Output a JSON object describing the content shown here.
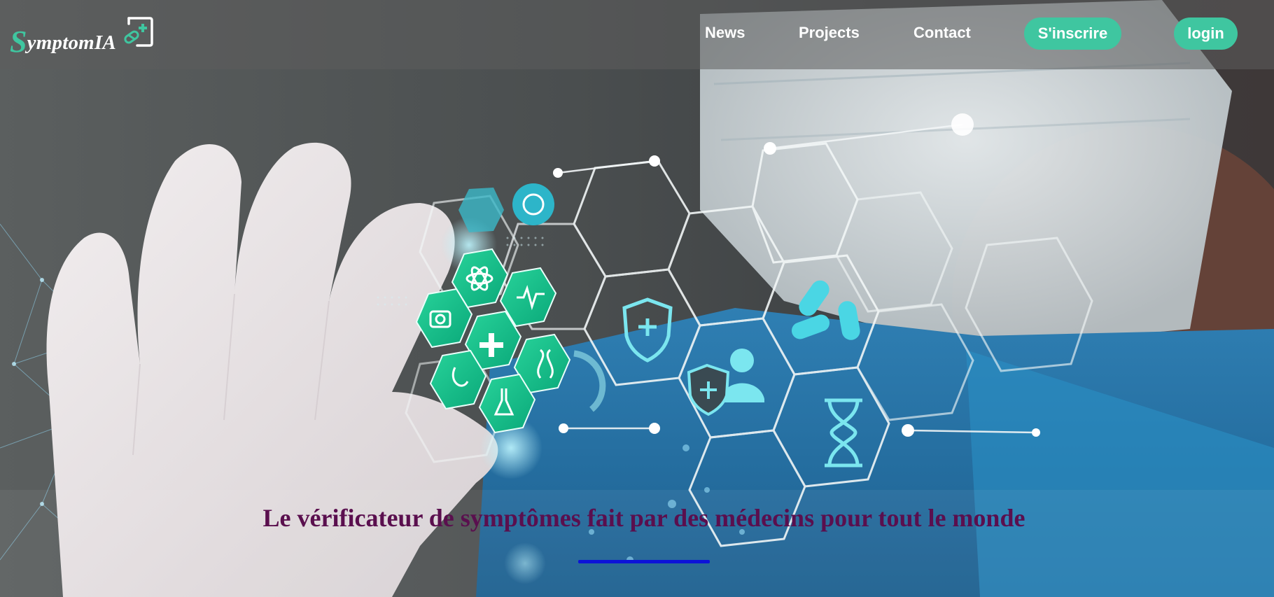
{
  "brand": {
    "name_first_letter": "S",
    "name_rest": "ymptomIA",
    "accent_color": "#3fc6a0",
    "icon": "medical-app-icon"
  },
  "nav": {
    "links": [
      {
        "label": "News"
      },
      {
        "label": "Projects"
      },
      {
        "label": "Contact"
      }
    ],
    "signup_label": "S'inscrire",
    "login_label": "login",
    "button_color": "#3fc6a0"
  },
  "hero": {
    "headline": "Le vérificateur de symptômes fait par des médecins pour tout le monde",
    "headline_color": "#5a0f4e",
    "underline_color": "#0c13d8",
    "background_image": "gloved hand holding medical hexagon icons in front of masked doctor",
    "icons": [
      "microscope-icon",
      "molecule-icon",
      "atom-icon",
      "heart-rate-icon",
      "camera-icon",
      "medical-cross-icon",
      "stethoscope-icon",
      "dna-icon",
      "flask-icon",
      "phone-icon",
      "shield-plus-icon",
      "doctor-shield-icon",
      "pills-icon",
      "hourglass-icon"
    ]
  }
}
